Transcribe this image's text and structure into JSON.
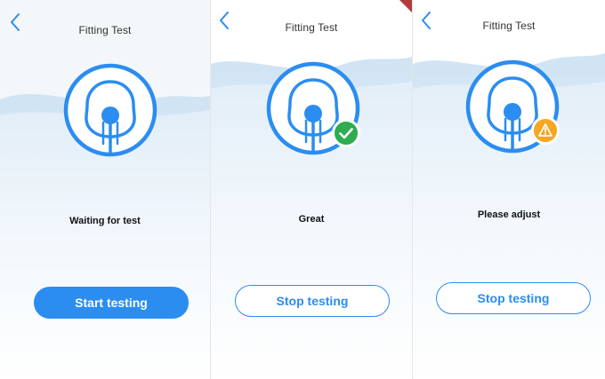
{
  "colors": {
    "accent": "#2b8df0",
    "success": "#2eac4f",
    "warning": "#f5a623",
    "text": "#111111"
  },
  "screens": [
    {
      "title": "Fitting Test",
      "status": "Waiting for test",
      "button": "Start testing",
      "badge": "none"
    },
    {
      "title": "Fitting Test",
      "status": "Great",
      "button": "Stop testing",
      "badge": "check-icon"
    },
    {
      "title": "Fitting Test",
      "status": "Please adjust",
      "button": "Stop testing",
      "badge": "warning-icon"
    }
  ]
}
